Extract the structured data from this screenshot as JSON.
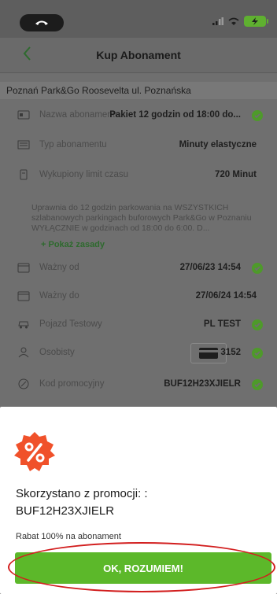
{
  "header": {
    "title": "Kup Abonament"
  },
  "parking": {
    "name": "Poznań Park&Go Roosevelta ul. Poznańska"
  },
  "rows": {
    "nazwa": {
      "label": "Nazwa abonamentu",
      "value": "Pakiet 12 godzin od 18:00 do..."
    },
    "typ": {
      "label": "Typ abonamentu",
      "value": "Minuty elastyczne"
    },
    "limit": {
      "label": "Wykupiony limit czasu",
      "value": "720 Minut"
    },
    "od": {
      "label": "Ważny od",
      "value": "27/06/23 14:54"
    },
    "do": {
      "label": "Ważny do",
      "value": "27/06/24 14:54"
    },
    "pojazd": {
      "label": "Pojazd Testowy",
      "value": "PL TEST"
    },
    "osobisty": {
      "label": "Osobisty",
      "value": "3152"
    },
    "kod": {
      "label": "Kod promocyjny",
      "value": "BUF12H23XJIELR"
    }
  },
  "description": "Uprawnia do 12 godzin parkowania na WSZYSTKICH szlabanowych parkingach buforowych Park&Go w Poznaniu WYŁĄCZNIE w godzinach od 18:00 do 6:00. D...",
  "show_rules": "+ Pokaż zasady",
  "sheet": {
    "title": "Skorzystano z promocji: :",
    "code": "BUF12H23XJIELR",
    "note": "Rabat 100% na abonament",
    "button": "OK, ROZUMIEM!"
  },
  "colors": {
    "accent": "#5cb82a",
    "highlight_ring": "#d21e1e"
  }
}
